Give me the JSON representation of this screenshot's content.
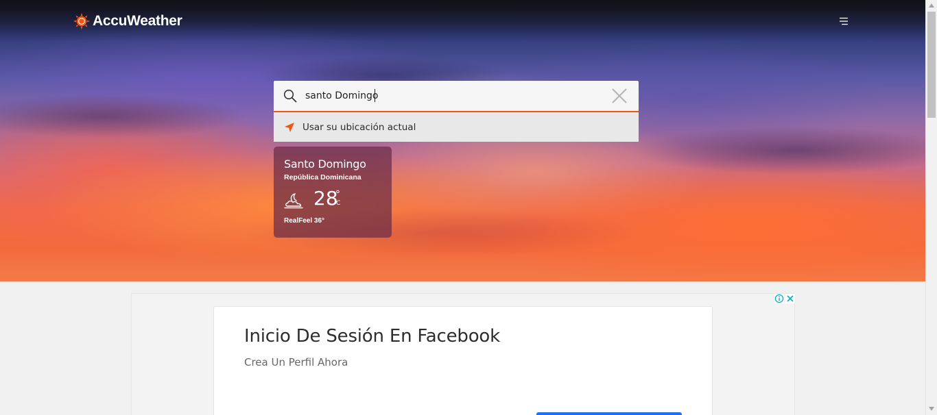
{
  "brand": {
    "name": "AccuWeather",
    "accent_color": "#f05514"
  },
  "header": {
    "menu_icon": "hamburger-menu-icon"
  },
  "search": {
    "value": "santo Domingo",
    "search_icon": "search-icon",
    "clear_icon": "close-icon"
  },
  "use_location": {
    "label": "Usar su ubicación actual",
    "icon": "location-arrow-icon"
  },
  "recent_location": {
    "city": "Santo Domingo",
    "country": "República Dominicana",
    "temperature": "28",
    "degree_symbol": "°",
    "unit": "C",
    "realfeel": "RealFeel 36°",
    "weather_icon": "moon-cloud-icon"
  },
  "ad": {
    "title": "Inicio De Sesión En Facebook",
    "subtitle": "Crea Un Perfil Ahora",
    "info_icon": "info-icon",
    "close_icon": "close-icon",
    "button_color": "#1a73e8"
  }
}
